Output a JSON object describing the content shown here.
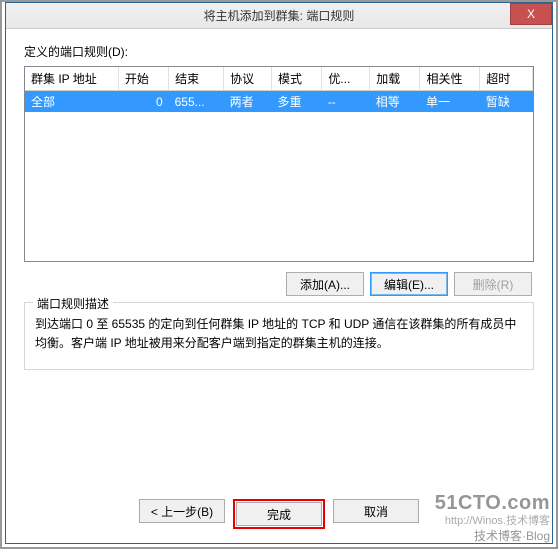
{
  "titlebar": {
    "text": "将主机添加到群集: 端口规则",
    "close": "X"
  },
  "labels": {
    "portRules": "定义的端口规则(D):"
  },
  "table": {
    "headers": [
      "群集 IP 地址",
      "开始",
      "结束",
      "协议",
      "模式",
      "优...",
      "加载",
      "相关性",
      "超时"
    ],
    "row": [
      "全部",
      "0",
      "655...",
      "两者",
      "多重",
      "--",
      "相等",
      "单一",
      "暂缺"
    ]
  },
  "buttons": {
    "add": "添加(A)...",
    "edit": "编辑(E)...",
    "remove": "删除(R)"
  },
  "groupbox": {
    "title": "端口规则描述",
    "desc": "到达端口 0 至 65535 的定向到任何群集 IP 地址的 TCP 和 UDP 通信在该群集的所有成员中均衡。客户端 IP 地址被用来分配客户端到指定的群集主机的连接。"
  },
  "footer": {
    "back": "< 上一步(B)",
    "finish": "完成",
    "cancel": "取消"
  },
  "watermark": {
    "brand": "51CTO.com",
    "url": "http://Winos.技术博客",
    "tag": "技术博客·Blog"
  }
}
